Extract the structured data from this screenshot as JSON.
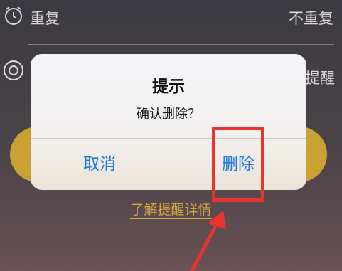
{
  "background": {
    "rows": [
      {
        "icon": "alarm-clock-icon",
        "label": "重复",
        "value": "不重复"
      },
      {
        "icon": "ring-icon",
        "label": "",
        "value": "提醒"
      }
    ],
    "detail_link": "了解提醒详情"
  },
  "dialog": {
    "title": "提示",
    "message": "确认删除？",
    "cancel_label": "取消",
    "delete_label": "删除"
  },
  "colors": {
    "accent_blue": "#1f7ae0",
    "gold": "#c9a233",
    "annotation_red": "#e8342f"
  }
}
